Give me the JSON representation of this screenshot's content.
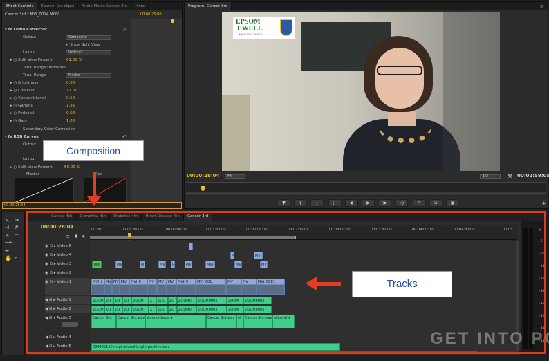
{
  "effect_controls": {
    "tabs": [
      "Effect Controls",
      "Source: (no clips)",
      "Audio Mixer: Cancer 3rd",
      "Meta"
    ],
    "clip_name": "Cancer 3rd * MVI_0014.MOV",
    "timecode_top": "00:00:25:00",
    "timecode_bottom": "00:00:28:04",
    "luma_corrector": "Luma Corrector",
    "output_label": "Output",
    "output_value": "Composite",
    "show_split_view": "Show Split View",
    "layout_label": "Layout",
    "layout_value": "Vertical",
    "split_view_percent_label": "Split View Percent",
    "split_view_percent_value": "61.00 %",
    "tonal_range_definition": "Tonal Range Definition",
    "tonal_range_label": "Tonal Range",
    "tonal_range_value": "Master",
    "brightness_label": "Brightness",
    "brightness_value": "0.00",
    "contrast_label": "Contrast",
    "contrast_value": "12.00",
    "contrast_level_label": "Contrast Level",
    "contrast_level_value": "0.50",
    "gamma_label": "Gamma",
    "gamma_value": "1.35",
    "pedestal_label": "Pedestal",
    "pedestal_value": "0.00",
    "gain_label": "Gain",
    "gain_value": "1.00",
    "secondary_color_correction": "Secondary Color Correction",
    "rgb_curves": "RGB Curves",
    "output2_label": "Output",
    "layout2_label": "Layout",
    "split_view_percent2_label": "Split View Percent",
    "split_view_percent2_value": "50.00 %",
    "master_label": "Master",
    "red_label": "Red"
  },
  "program_monitor": {
    "tab": "Program: Cancer 3rd",
    "logo_line1": "EPSOM",
    "logo_line2": "EWELL",
    "logo_line3": "BOROUGH COUNCIL",
    "timecode_current": "00:00:28:04",
    "fit_value": "Fit",
    "resolution_value": "1/2",
    "timecode_duration": "00:02:59:05",
    "controls": [
      "▼",
      "{",
      "}",
      "{→",
      "◀|",
      "▶",
      "|▶",
      "→}",
      "⊓",
      "⊔",
      "▣"
    ]
  },
  "timeline": {
    "tabs": [
      "Cancer 4th",
      "Dementia 4th",
      "Diabetes 4th",
      "Heart Disease 4th",
      "Cancer 3rd"
    ],
    "timecode": "00:00:28:04",
    "ruler": [
      "00:00",
      "00:00:30:00",
      "00:01:00:00",
      "00:01:30:00",
      "00:02:00:00",
      "00:02:30:00",
      "00:03:00:00",
      "00:03:30:00",
      "00:04:00:00",
      "00:04:30:00",
      "00:05"
    ],
    "tracks": [
      "Video 5",
      "Video 4",
      "Video 3",
      "Video 2",
      "Video 1",
      "Audio 1",
      "Audio 2",
      "Audio 3",
      "Audio 4",
      "Audio 5"
    ],
    "v5_clips": [
      ""
    ],
    "v4_clips": [
      "M",
      "MV"
    ],
    "v3_clips": [
      "Texi",
      "MV",
      "M",
      "MV",
      "P",
      "MV",
      "MVI",
      "MV",
      "MV"
    ],
    "v1_clips": [
      "MVI_(",
      "MV",
      "MV",
      "MVI",
      "MVI_0",
      "MV",
      "MV",
      "MV",
      "MVI_0",
      "MVI_001",
      "MV",
      "MV",
      "MVI_0013."
    ],
    "a1_clips": [
      "ZOOM",
      "ZO",
      "ZO",
      "ZO",
      "ZOOM",
      "Z",
      "ZOO",
      "ZO",
      "ZOOM0",
      "ZOOM0003",
      "ZOOM",
      "ZOOM0003"
    ],
    "a2_clips": [
      "ZOOM",
      "ZO",
      "ZO",
      "ZO",
      "ZOOM",
      "Z",
      "ZOO",
      "ZO",
      "ZOOM0",
      "ZOOM0003",
      "ZOOM",
      "ZOOM0003"
    ],
    "a3_clips": [
      "Cancer 3rd",
      "Cancer 3rd.wav",
      "Volume:Level ▾",
      "Cancer 3rd.wav",
      "el",
      "Cancer 3rd.wav",
      "el:Level ▾"
    ],
    "a5_clip": "034465138-inspirational-bright-positive.wav",
    "meter_labels": [
      "0",
      "-6",
      "-12",
      "-18",
      "-24",
      "-30",
      "-36",
      "-42",
      "-48",
      "-54"
    ]
  },
  "annotations": {
    "composition": "Composition",
    "tracks": "Tracks"
  },
  "watermark": "GET INTO PC"
}
